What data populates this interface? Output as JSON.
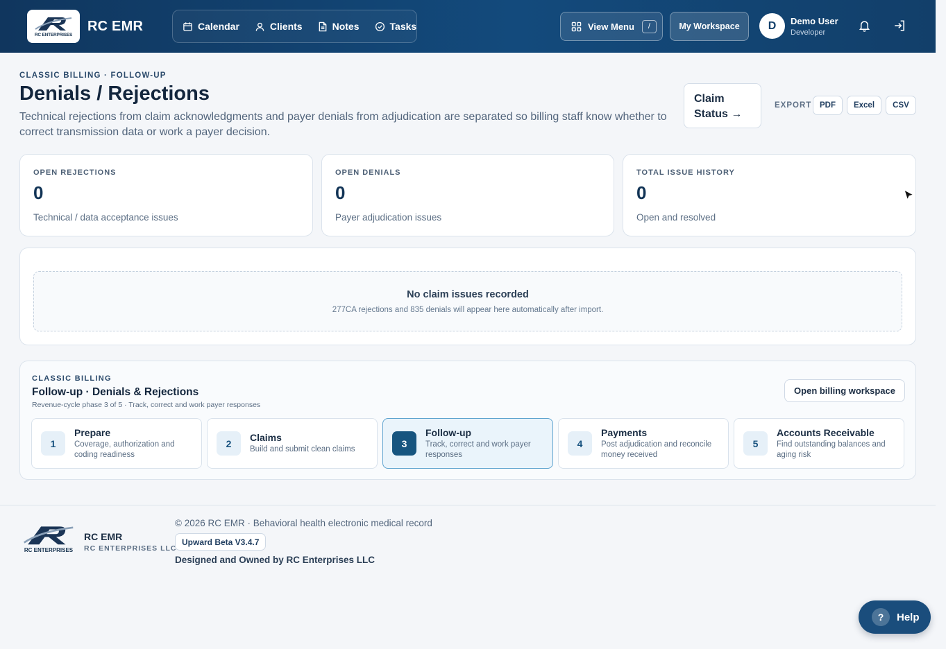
{
  "header": {
    "brand_name": "RC EMR",
    "logo_text": "RC ENTERPRISES",
    "nav": [
      {
        "label": "Calendar",
        "icon": "calendar-icon"
      },
      {
        "label": "Clients",
        "icon": "user-icon"
      },
      {
        "label": "Notes",
        "icon": "document-icon"
      },
      {
        "label": "Tasks",
        "icon": "check-circle-icon"
      }
    ],
    "view_menu_label": "View Menu",
    "view_menu_shortcut": "/",
    "workspace_label": "My Workspace",
    "user": {
      "initial": "D",
      "name": "Demo User",
      "role": "Developer"
    }
  },
  "page": {
    "eyebrow": "CLASSIC BILLING · FOLLOW-UP",
    "title": "Denials / Rejections",
    "description": "Technical rejections from claim acknowledgments and payer denials from adjudication are separated so billing staff know whether to correct transmission data or work a payer decision.",
    "claim_status_line1": "Claim",
    "claim_status_line2": "Status →",
    "export_label": "EXPORT",
    "export_buttons": [
      "PDF",
      "Excel",
      "CSV"
    ]
  },
  "stats": [
    {
      "label": "OPEN REJECTIONS",
      "value": "0",
      "desc": "Technical / data acceptance issues"
    },
    {
      "label": "OPEN DENIALS",
      "value": "0",
      "desc": "Payer adjudication issues"
    },
    {
      "label": "TOTAL ISSUE HISTORY",
      "value": "0",
      "desc": "Open and resolved"
    }
  ],
  "issues": {
    "empty_title": "No claim issues recorded",
    "empty_subtitle": "277CA rejections and 835 denials will appear here automatically after import."
  },
  "phase": {
    "eyebrow": "CLASSIC BILLING",
    "title": "Follow-up · Denials & Rejections",
    "subtitle": "Revenue-cycle phase 3 of 5 · Track, correct and work payer responses",
    "open_button": "Open billing workspace",
    "steps": [
      {
        "num": "1",
        "title": "Prepare",
        "desc": "Coverage, authorization and coding readiness"
      },
      {
        "num": "2",
        "title": "Claims",
        "desc": "Build and submit clean claims"
      },
      {
        "num": "3",
        "title": "Follow-up",
        "desc": "Track, correct and work payer responses",
        "active": true
      },
      {
        "num": "4",
        "title": "Payments",
        "desc": "Post adjudication and reconcile money received"
      },
      {
        "num": "5",
        "title": "Accounts Receivable",
        "desc": "Find outstanding balances and aging risk"
      }
    ]
  },
  "footer": {
    "logo_text": "RC ENTERPRISES",
    "brand": "RC EMR",
    "company": "RC ENTERPRISES LLC",
    "copyright": "© 2026 RC EMR · Behavioral health electronic medical record",
    "version": "Upward Beta V3.4.7",
    "owned": "Designed and Owned by RC Enterprises LLC"
  },
  "help_label": "Help",
  "help_icon_glyph": "?",
  "colors": {
    "header": "#134a7c",
    "accent": "#17557f",
    "active_step_bg": "#eaf4fb"
  }
}
